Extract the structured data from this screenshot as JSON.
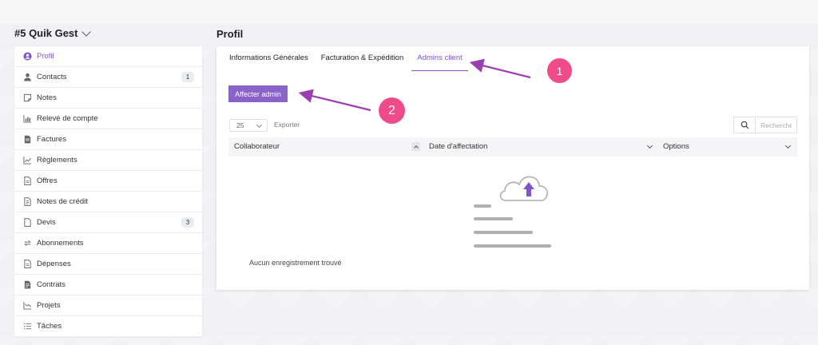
{
  "company": {
    "name": "#5 Quik Gest"
  },
  "sidebar": {
    "items": [
      {
        "label": "Profil",
        "icon": "user-circle-icon",
        "active": true
      },
      {
        "label": "Contacts",
        "icon": "person-icon",
        "badge": "1"
      },
      {
        "label": "Notes",
        "icon": "note-icon"
      },
      {
        "label": "Relevé de compte",
        "icon": "bar-chart-icon"
      },
      {
        "label": "Factures",
        "icon": "document-icon"
      },
      {
        "label": "Règlements",
        "icon": "line-chart-icon"
      },
      {
        "label": "Offres",
        "icon": "file-text-icon"
      },
      {
        "label": "Notes de crédit",
        "icon": "file-lines-icon"
      },
      {
        "label": "Devis",
        "icon": "file-icon",
        "badge": "3"
      },
      {
        "label": "Abonnements",
        "icon": "refresh-icon"
      },
      {
        "label": "Dépenses",
        "icon": "receipt-icon"
      },
      {
        "label": "Contrats",
        "icon": "contract-icon"
      },
      {
        "label": "Projets",
        "icon": "project-chart-icon"
      },
      {
        "label": "Tâches",
        "icon": "task-list-icon"
      }
    ]
  },
  "page": {
    "title": "Profil"
  },
  "tabs": [
    {
      "label": "Informations Générales",
      "active": false
    },
    {
      "label": "Facturation & Expédition",
      "active": false
    },
    {
      "label": "Admins client",
      "active": true
    }
  ],
  "toolbar": {
    "assign_label": "Affecter admin",
    "per_page": "25",
    "export_label": "Exporter",
    "search_placeholder": "Rechercher"
  },
  "table": {
    "columns": [
      "Collaborateur",
      "Date d'affectation",
      "Options"
    ],
    "empty_message": "Aucun enregistrement trouvé"
  },
  "annotations": {
    "badge1": "1",
    "badge2": "2"
  },
  "colors": {
    "accent": "#7e57c2",
    "button": "#8a63c9",
    "annotation": "#ef4a8a",
    "annotation_arrow": "#9b3fb0"
  }
}
